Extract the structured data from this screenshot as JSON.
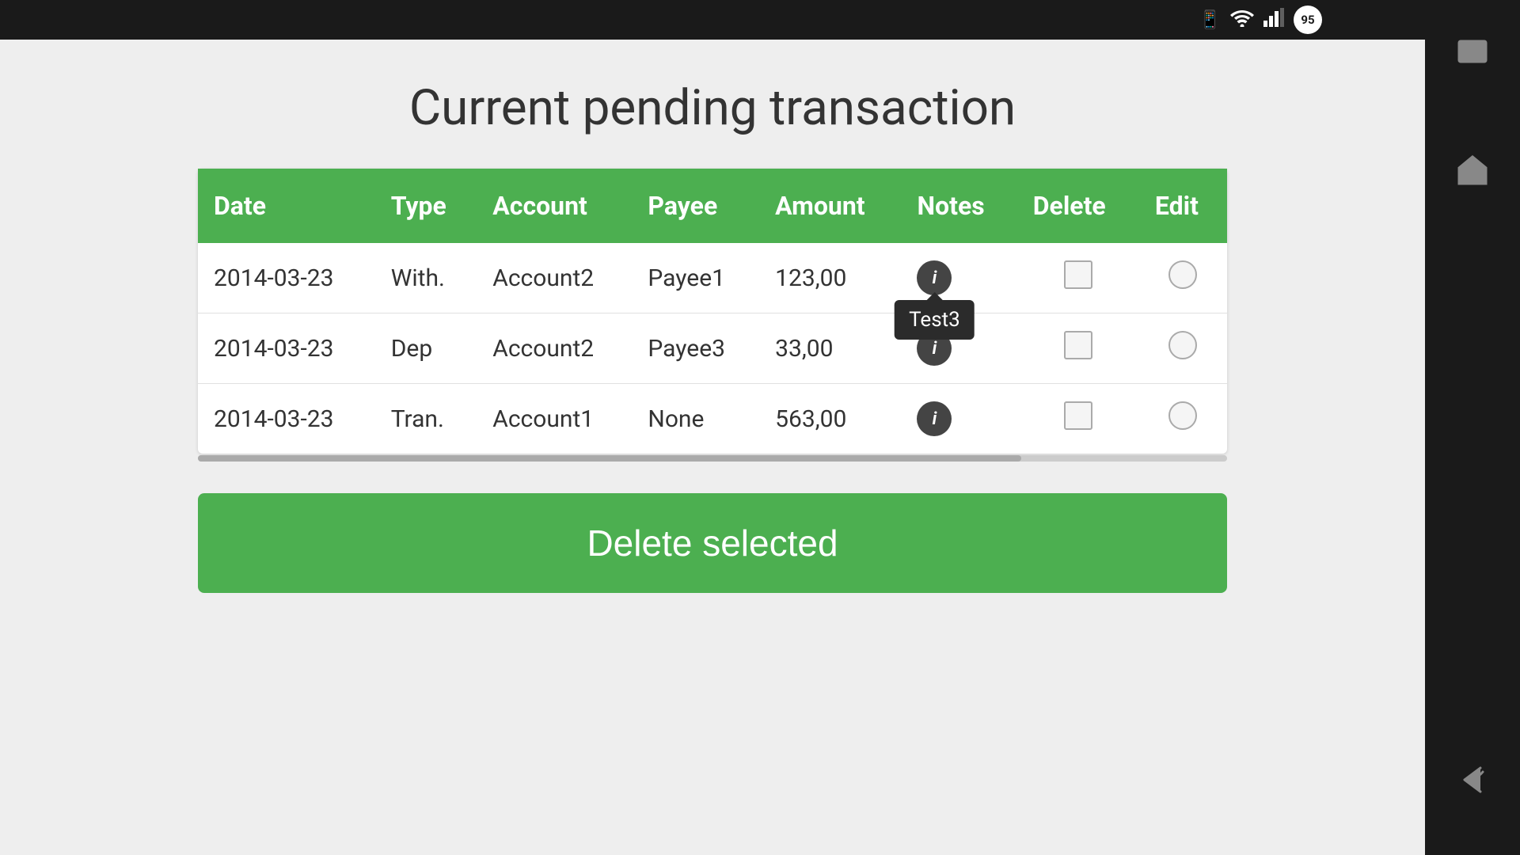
{
  "statusBar": {
    "batteryLevel": "95"
  },
  "page": {
    "title": "Current pending transaction"
  },
  "table": {
    "headers": {
      "date": "Date",
      "type": "Type",
      "account": "Account",
      "payee": "Payee",
      "amount": "Amount",
      "notes": "Notes",
      "delete": "Delete",
      "edit": "Edit"
    },
    "rows": [
      {
        "date": "2014-03-23",
        "type": "With.",
        "account": "Account2",
        "payee": "Payee1",
        "amount": "123,00",
        "noteTooltip": "Test3",
        "showTooltip": true
      },
      {
        "date": "2014-03-23",
        "type": "Dep",
        "account": "Account2",
        "payee": "Payee3",
        "amount": "33,00",
        "noteTooltip": "",
        "showTooltip": false
      },
      {
        "date": "2014-03-23",
        "type": "Tran.",
        "account": "Account1",
        "payee": "None",
        "amount": "563,00",
        "noteTooltip": "",
        "showTooltip": false
      }
    ]
  },
  "buttons": {
    "deleteSelected": "Delete selected"
  }
}
